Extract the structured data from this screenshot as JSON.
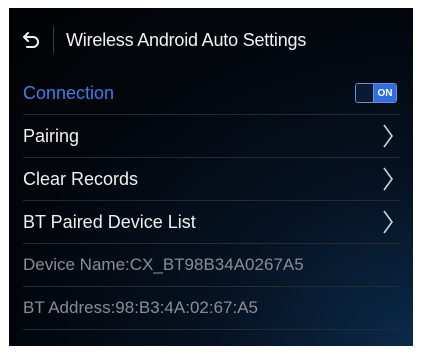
{
  "header": {
    "title": "Wireless Android Auto Settings"
  },
  "settings": {
    "connection": {
      "label": "Connection",
      "toggle_state": "ON"
    },
    "pairing_label": "Pairing",
    "clear_records_label": "Clear Records",
    "bt_paired_list_label": "BT Paired Device List",
    "device_name": "Device Name:CX_BT98B34A0267A5",
    "bt_address": "BT Address:98:B3:4A:02:67:A5"
  },
  "colors": {
    "accent": "#3b7fe6",
    "toggle_on": "#2f6fe0",
    "background": "#02060c"
  },
  "icons": {
    "back": "back-arrow-icon",
    "chevron": "chevron-right-icon"
  }
}
